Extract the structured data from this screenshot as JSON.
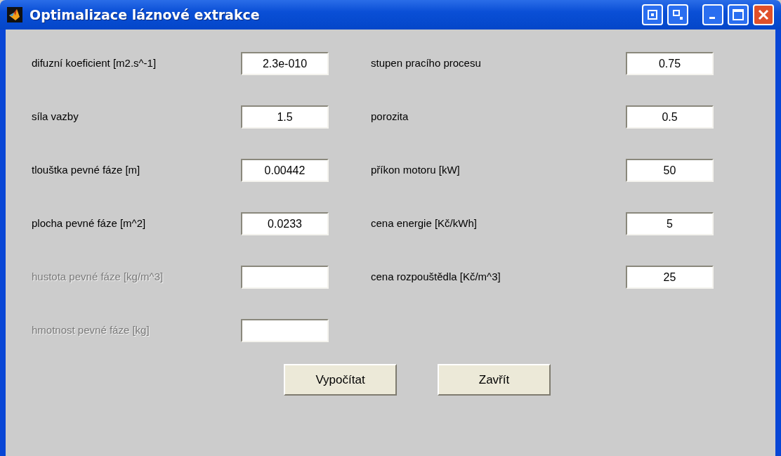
{
  "window": {
    "title": "Optimalizace láznové extrakce"
  },
  "left_fields": [
    {
      "label": "difuzní koeficient [m2.s^-1]",
      "value": "2.3e-010",
      "disabled": false
    },
    {
      "label": "síla vazby",
      "value": "1.5",
      "disabled": false
    },
    {
      "label": "tlouštka pevné fáze [m]",
      "value": "0.00442",
      "disabled": false
    },
    {
      "label": "plocha pevné fáze [m^2]",
      "value": "0.0233",
      "disabled": false
    },
    {
      "label": "hustota pevné fáze [kg/m^3]",
      "disabled": true
    },
    {
      "label": "hmotnost pevné fáze [kg]",
      "disabled": true
    }
  ],
  "right_fields": [
    {
      "label": "stupen pracího procesu",
      "value": "0.75",
      "disabled": false
    },
    {
      "label": "porozita",
      "value": "0.5",
      "disabled": false
    },
    {
      "label": "příkon motoru [kW]",
      "value": "50",
      "disabled": false
    },
    {
      "label": "cena energie [Kč/kWh]",
      "value": "5",
      "disabled": false
    },
    {
      "label": "cena rozpouštědla [Kč/m^3]",
      "value": "25",
      "disabled": false
    }
  ],
  "buttons": [
    "Vypočítat",
    "Zavřít"
  ]
}
